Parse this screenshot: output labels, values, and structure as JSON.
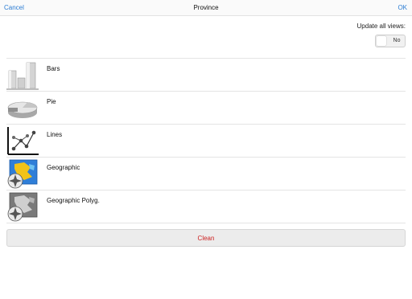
{
  "navbar": {
    "cancel_label": "Cancel",
    "title": "Province",
    "ok_label": "OK"
  },
  "settings": {
    "update_all_views_label": "Update all views:",
    "update_all_views_value": "No"
  },
  "chart_types": [
    {
      "label": "Bars",
      "icon": "bars-chart-icon"
    },
    {
      "label": "Pie",
      "icon": "pie-chart-icon"
    },
    {
      "label": "Lines",
      "icon": "line-chart-icon"
    },
    {
      "label": "Geographic",
      "icon": "geographic-map-icon"
    },
    {
      "label": "Geographic Polyg.",
      "icon": "geographic-polygon-icon"
    }
  ],
  "clean_label": "Clean",
  "colors": {
    "accent": "#2b7cd3",
    "destructive": "#cc2222"
  }
}
